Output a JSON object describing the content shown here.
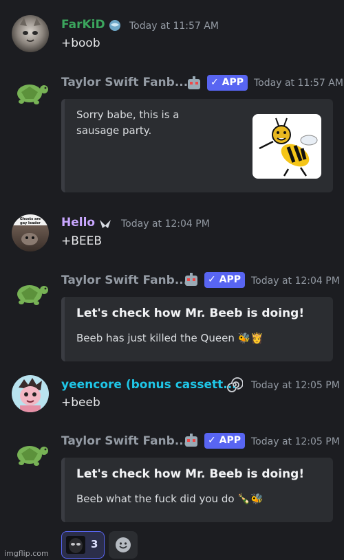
{
  "messages": [
    {
      "username": "FarKiD",
      "username_color": "#3ba55d",
      "timestamp": "Today at 11:57 AM",
      "content": "+boob",
      "avatar": "cat-avatar"
    },
    {
      "username": "Taylor Swift Fanb...",
      "username_color": "#949ba4",
      "timestamp": "Today at 11:57 AM",
      "badge": "✓ APP",
      "avatar": "turtle-avatar",
      "embed": {
        "description_line1": "Sorry babe, this is a",
        "description_line2": "sausage party.",
        "thumbnail": "bee-drawing"
      }
    },
    {
      "username": "Hello",
      "username_color": "#c9a7ff",
      "timestamp": "Today at 12:04 PM",
      "content": "+BEEB",
      "avatar_caption": "Ghosts are gay leader",
      "avatar": "photo-avatar"
    },
    {
      "username": "Taylor Swift Fanb...",
      "username_color": "#949ba4",
      "timestamp": "Today at 12:04 PM",
      "badge": "✓ APP",
      "avatar": "turtle-avatar",
      "embed": {
        "title": "Let's check how Mr. Beeb is doing!",
        "description": "Beeb has just killed the Queen 🐝👸"
      }
    },
    {
      "username": "yeencore (bonus cassett...",
      "username_color": "#1fc7e8",
      "timestamp": "Today at 12:05 PM",
      "content": "+beeb",
      "avatar": "drawn-avatar"
    },
    {
      "username": "Taylor Swift Fanb...",
      "username_color": "#949ba4",
      "timestamp": "Today at 12:05 PM",
      "badge": "✓ APP",
      "avatar": "turtle-avatar",
      "embed": {
        "title": "Let's check how Mr. Beeb is doing!",
        "description": "Beeb what the fuck did you do 🍾🐝"
      }
    }
  ],
  "reaction": {
    "count": "3",
    "emoji": "face-emoji"
  },
  "add_reaction": {
    "icon": "smiley-icon"
  },
  "watermark": "imgflip.com",
  "colors": {
    "background": "#1c1d21",
    "embed_bg": "#2b2d31",
    "app_badge": "#5865f2"
  }
}
